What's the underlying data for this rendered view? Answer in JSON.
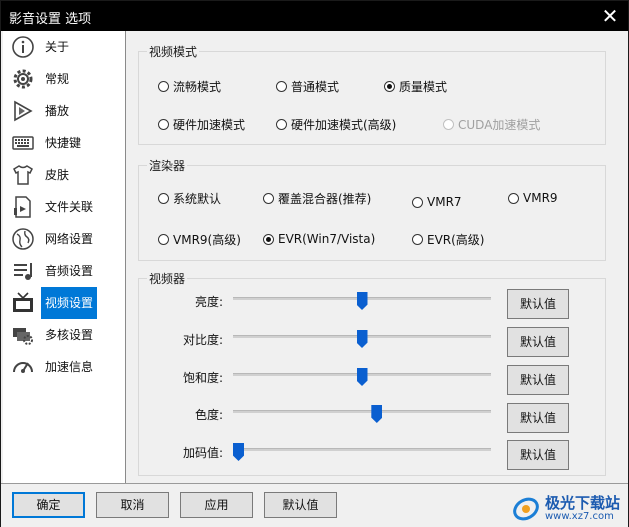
{
  "window": {
    "title": "影音设置 选项",
    "close_glyph": "✕"
  },
  "sidebar": {
    "items": [
      {
        "label": "关于",
        "icon": "info-icon"
      },
      {
        "label": "常规",
        "icon": "gear-icon"
      },
      {
        "label": "播放",
        "icon": "play-icon"
      },
      {
        "label": "快捷键",
        "icon": "keyboard-icon"
      },
      {
        "label": "皮肤",
        "icon": "shirt-icon"
      },
      {
        "label": "文件关联",
        "icon": "file-icon"
      },
      {
        "label": "网络设置",
        "icon": "globe-icon"
      },
      {
        "label": "音频设置",
        "icon": "audio-icon"
      },
      {
        "label": "视频设置",
        "icon": "tv-icon"
      },
      {
        "label": "多核设置",
        "icon": "cpu-icon"
      },
      {
        "label": "加速信息",
        "icon": "speedometer-icon"
      }
    ],
    "active_index": 8
  },
  "video_mode": {
    "title": "视频模式",
    "options": [
      {
        "label": "流畅模式",
        "checked": false
      },
      {
        "label": "普通模式",
        "checked": false
      },
      {
        "label": "质量模式",
        "checked": true
      },
      {
        "label": "硬件加速模式",
        "checked": false
      },
      {
        "label": "硬件加速模式(高级)",
        "checked": false
      },
      {
        "label": "CUDA加速模式",
        "checked": false,
        "disabled": true
      }
    ]
  },
  "renderer": {
    "title": "渲染器",
    "options": [
      {
        "label": "系统默认",
        "checked": false
      },
      {
        "label": "覆盖混合器(推荐)",
        "checked": false
      },
      {
        "label": "VMR7",
        "checked": false
      },
      {
        "label": "VMR9",
        "checked": false
      },
      {
        "label": "VMR9(高级)",
        "checked": false
      },
      {
        "label": "EVR(Win7/Vista)",
        "checked": true
      },
      {
        "label": "EVR(高级)",
        "checked": false
      }
    ]
  },
  "video_controls": {
    "title": "视频器",
    "sliders": [
      {
        "label": "亮度:",
        "level": 0.5,
        "button": "默认值"
      },
      {
        "label": "对比度:",
        "level": 0.5,
        "button": "默认值"
      },
      {
        "label": "饱和度:",
        "level": 0.5,
        "button": "默认值"
      },
      {
        "label": "色度:",
        "level": 0.56,
        "button": "默认值"
      },
      {
        "label": "加码值:",
        "level": 0.0,
        "button": "默认值"
      }
    ]
  },
  "footer": {
    "ok": "确定",
    "cancel": "取消",
    "apply": "应用",
    "default": "默认值"
  },
  "watermark": {
    "name": "极光下载站",
    "url": "www.xz7.com"
  },
  "colors": {
    "accent": "#0078d7",
    "slider": "#0a5fd0",
    "titlebar": "#000000"
  }
}
